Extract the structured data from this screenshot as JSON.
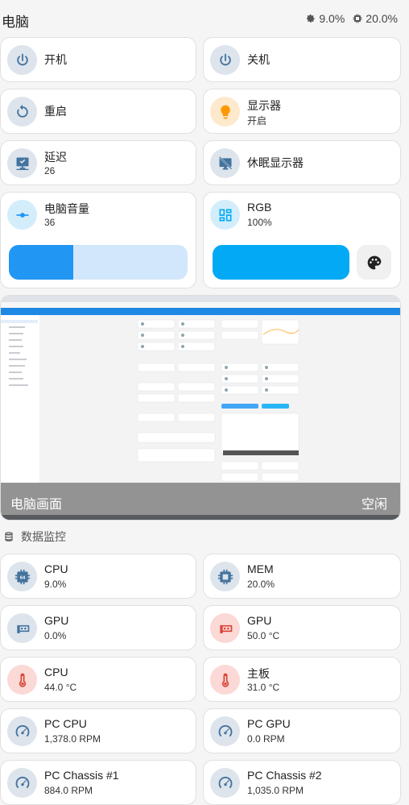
{
  "header": {
    "title": "电脑",
    "cpu_stat": "9.0%",
    "mem_stat": "20.0%"
  },
  "controls": {
    "power_on": {
      "name": "开机",
      "icon": "power-icon"
    },
    "power_off": {
      "name": "关机",
      "icon": "power-icon"
    },
    "restart": {
      "name": "重启",
      "icon": "restart-icon"
    },
    "display": {
      "name": "显示器",
      "state": "开启",
      "icon": "lightbulb-icon"
    },
    "latency": {
      "name": "延迟",
      "value": "26",
      "icon": "monitor-network-icon"
    },
    "sleep_display": {
      "name": "休眠显示器",
      "icon": "monitor-off-icon"
    },
    "volume": {
      "name": "电脑音量",
      "value": "36",
      "level_percent": 36,
      "icon": "volume-slider-icon"
    },
    "rgb": {
      "name": "RGB",
      "value": "100%",
      "level_percent": 100,
      "icon": "dashboard-grid-icon"
    }
  },
  "screen": {
    "caption": "电脑画面",
    "status": "空闲"
  },
  "section": {
    "title": "数据监控"
  },
  "sensors": [
    {
      "name": "CPU",
      "value": "9.0%",
      "icon": "cpu-64bit-icon",
      "tone": "blue"
    },
    {
      "name": "MEM",
      "value": "20.0%",
      "icon": "chip-icon",
      "tone": "blue"
    },
    {
      "name": "GPU",
      "value": "0.0%",
      "icon": "gpu-card-icon",
      "tone": "blue"
    },
    {
      "name": "GPU",
      "value": "50.0 °C",
      "icon": "gpu-card-icon",
      "tone": "red"
    },
    {
      "name": "CPU",
      "value": "44.0 °C",
      "icon": "thermometer-icon",
      "tone": "red"
    },
    {
      "name": "主板",
      "value": "31.0 °C",
      "icon": "thermometer-icon",
      "tone": "red"
    },
    {
      "name": "PC CPU",
      "value": "1,378.0 RPM",
      "icon": "gauge-icon",
      "tone": "blue"
    },
    {
      "name": "PC GPU",
      "value": "0.0 RPM",
      "icon": "gauge-icon",
      "tone": "blue"
    },
    {
      "name": "PC Chassis #1",
      "value": "884.0 RPM",
      "icon": "gauge-icon",
      "tone": "blue"
    },
    {
      "name": "PC Chassis #2",
      "value": "1,035.0 RPM",
      "icon": "gauge-icon",
      "tone": "blue"
    }
  ],
  "colors": {
    "accent_blue": "#2196f3",
    "rgb_blue": "#03a9f4",
    "icon_blue": "#44739e",
    "icon_red": "#db4437",
    "icon_orange": "#ff9800"
  }
}
